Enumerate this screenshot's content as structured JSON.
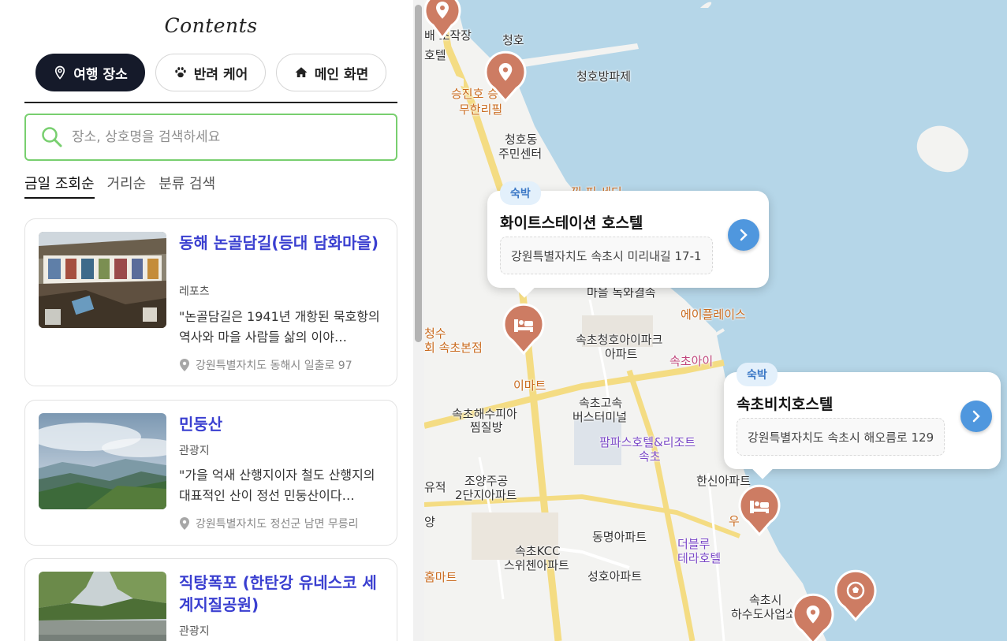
{
  "header": {
    "logo": "Contents"
  },
  "tabs": [
    {
      "label": "여행 장소",
      "icon": "location-pin-icon",
      "active": true
    },
    {
      "label": "반려 케어",
      "icon": "paw-icon",
      "active": false
    },
    {
      "label": "메인 화면",
      "icon": "home-icon",
      "active": false
    }
  ],
  "search": {
    "placeholder": "장소, 상호명을 검색하세요",
    "value": ""
  },
  "sort": {
    "today": "금일 조회순",
    "distance": "거리순",
    "category": "분류 검색"
  },
  "places": [
    {
      "title": "동해 논골담길(등대 담화마을)",
      "category": "레포츠",
      "description": "\"논골담길은 1941년 개항된 묵호항의 역사와 마을 사람들 삶의 이야…",
      "address": "강원특별자치도 동해시 일출로 97"
    },
    {
      "title": "민둥산",
      "category": "관광지",
      "description": "\"가을 억새 산행지이자 철도 산행지의 대표적인 산이 정선 민둥산이다…",
      "address": "강원특별자치도 정선군 남면 무릉리"
    },
    {
      "title": "직탕폭포 (한탄강 유네스코 세계지질공원)",
      "category": "관광지",
      "description": "",
      "address": ""
    }
  ],
  "map": {
    "labels": {
      "l1": "배 조작장",
      "l2": "호텔",
      "l3": "청호",
      "l4": "청호방파제",
      "l5": "승진호 승",
      "l6": "무한리필",
      "l7": "청호동",
      "l8": "주민센터",
      "l9": "마을 독와결속",
      "l10": "에이플레이스",
      "l11": "청수",
      "l12": "회 속초본점",
      "l13": "속초청호아이파크",
      "l14": "아파트",
      "l15": "속초아이",
      "l16": "이마트",
      "l17": "속초고속",
      "l18": "버스터미널",
      "l19": "속초해수피아",
      "l20": "찜질방",
      "l21": "팜파스호텔&리조트",
      "l22": "속초",
      "l23": "유적",
      "l24": "조양주공",
      "l25": "2단지아파트",
      "l26": "한신아파트",
      "l27": "우",
      "l28": "양",
      "l29": "동명아파트",
      "l30": "더블루",
      "l31": "테라호텔",
      "l32": "속초KCC",
      "l33": "스위첸아파트",
      "l34": "성호아파트",
      "l35": "홈마트",
      "l36": "속초시",
      "l37": "하수도사업소",
      "l38": "낑 피 세티"
    },
    "popups": [
      {
        "badge": "숙박",
        "name": "화이트스테이션 호스텔",
        "address": "강원특별자치도 속초시 미리내길 17-1"
      },
      {
        "badge": "숙박",
        "name": "속초비치호스텔",
        "address": "강원특별자치도 속초시 해오름로 129"
      }
    ],
    "colors": {
      "sea": "#b5d6e8",
      "land": "#f3f3f1",
      "road_main": "#f4dc83",
      "marker": "#cd7c63",
      "accent": "#4f97de"
    }
  }
}
